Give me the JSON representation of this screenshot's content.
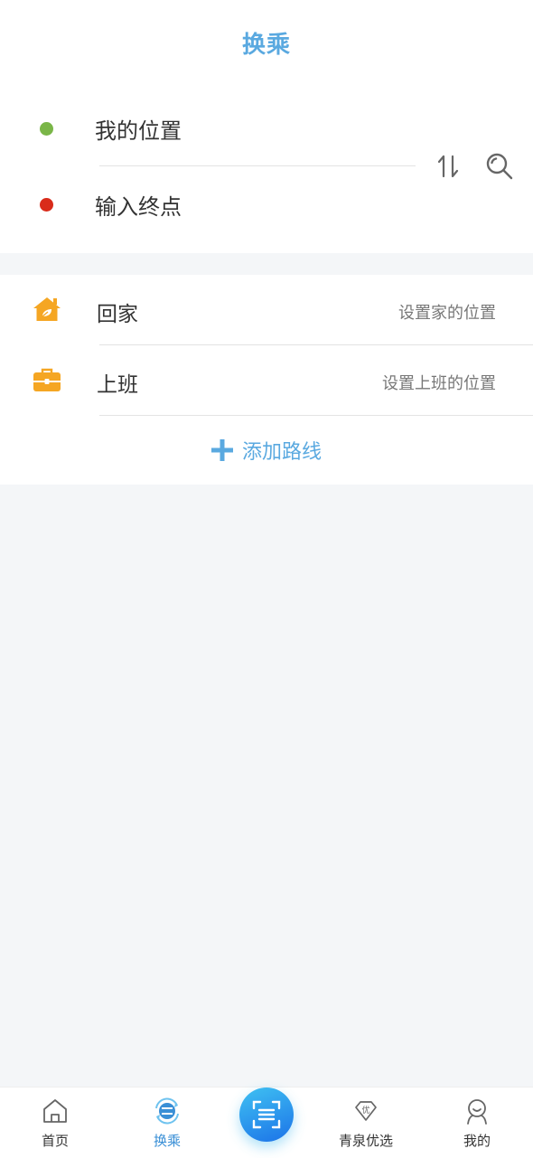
{
  "header": {
    "title": "换乘"
  },
  "route": {
    "start_label": "我的位置",
    "end_label": "输入终点",
    "start_color": "#7ab648",
    "end_color": "#d92b1a"
  },
  "favorites": {
    "home": {
      "label": "回家",
      "hint": "设置家的位置",
      "icon": "home-icon"
    },
    "work": {
      "label": "上班",
      "hint": "设置上班的位置",
      "icon": "briefcase-icon"
    },
    "add_route_label": "添加路线"
  },
  "tabbar": {
    "items": [
      {
        "label": "首页",
        "icon": "home-outline-icon"
      },
      {
        "label": "换乘",
        "icon": "transfer-icon",
        "active": true
      },
      {
        "label": "",
        "icon": "scan-icon"
      },
      {
        "label": "青泉优选",
        "icon": "diamond-icon"
      },
      {
        "label": "我的",
        "icon": "user-icon"
      }
    ]
  },
  "colors": {
    "accent": "#5aa9e0",
    "active_tab": "#3a8fd6",
    "favorite_icon": "#f5a623"
  }
}
